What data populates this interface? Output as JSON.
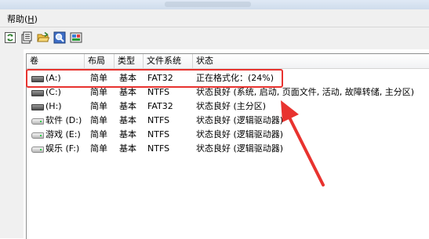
{
  "menu": {
    "help_label": "帮助(",
    "help_key": "H",
    "help_close": ")"
  },
  "toolbar": {
    "buttons": [
      {
        "icon": "refresh-icon"
      },
      {
        "icon": "properties-icon"
      },
      {
        "icon": "open-folder-icon"
      },
      {
        "icon": "search-icon"
      },
      {
        "icon": "disk-settings-icon"
      }
    ]
  },
  "table": {
    "columns": [
      "卷",
      "布局",
      "类型",
      "文件系统",
      "状态"
    ],
    "rows": [
      {
        "volume": "(A:)",
        "layout": "简单",
        "type": "基本",
        "fs": "FAT32",
        "status": "正在格式化：(24%)",
        "icon": "drive-dark-icon"
      },
      {
        "volume": "(C:)",
        "layout": "简单",
        "type": "基本",
        "fs": "NTFS",
        "status": "状态良好 (系统, 启动, 页面文件, 活动, 故障转储, 主分区)",
        "icon": "drive-dark-icon"
      },
      {
        "volume": "(H:)",
        "layout": "简单",
        "type": "基本",
        "fs": "FAT32",
        "status": "状态良好 (主分区)",
        "icon": "drive-dark-icon"
      },
      {
        "volume": "软件 (D:)",
        "layout": "简单",
        "type": "基本",
        "fs": "NTFS",
        "status": "状态良好 (逻辑驱动器)",
        "icon": "drive-light-icon"
      },
      {
        "volume": "游戏 (E:)",
        "layout": "简单",
        "type": "基本",
        "fs": "NTFS",
        "status": "状态良好 (逻辑驱动器)",
        "icon": "drive-light-icon"
      },
      {
        "volume": "娱乐 (F:)",
        "layout": "简单",
        "type": "基本",
        "fs": "NTFS",
        "status": "状态良好 (逻辑驱动器)",
        "icon": "drive-light-icon"
      }
    ]
  },
  "colors": {
    "annotation": "#e8332f",
    "header_border": "#d5d5d5"
  }
}
